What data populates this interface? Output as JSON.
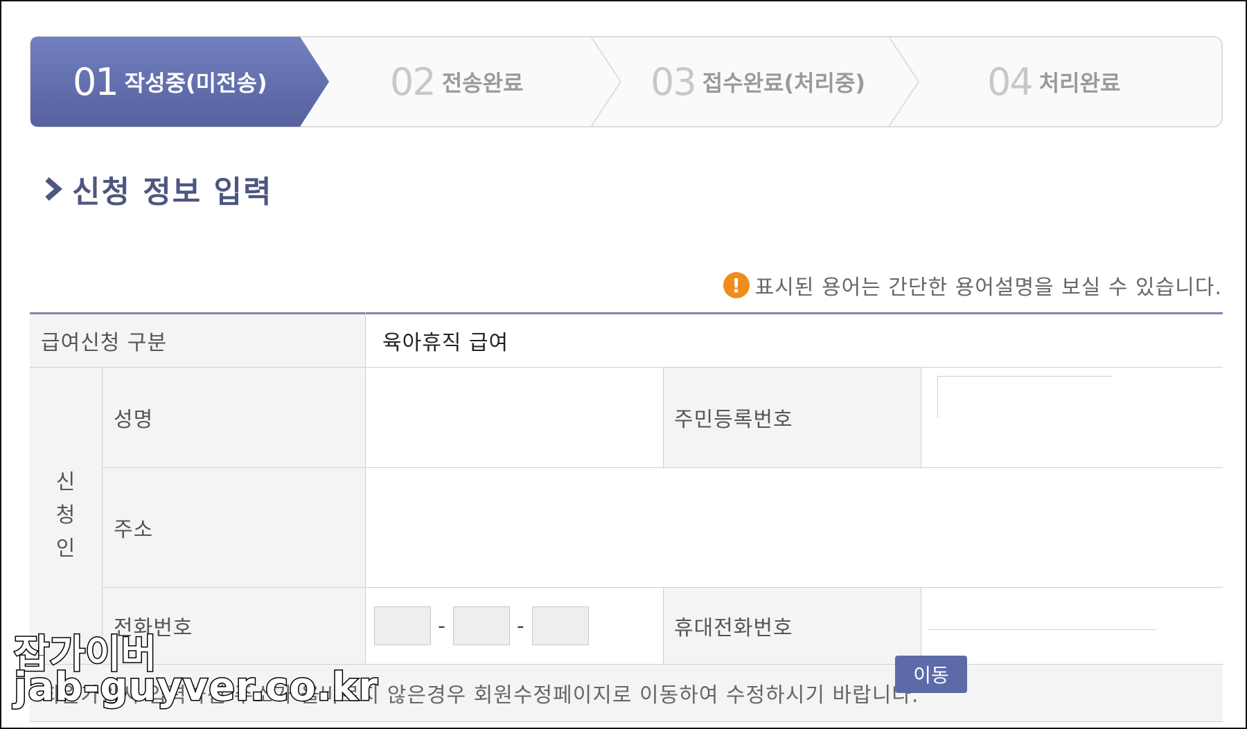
{
  "steps": [
    {
      "num": "01",
      "label": "작성중(미전송)",
      "active": true
    },
    {
      "num": "02",
      "label": "전송완료",
      "active": false
    },
    {
      "num": "03",
      "label": "접수완료(처리중)",
      "active": false
    },
    {
      "num": "04",
      "label": "처리완료",
      "active": false
    }
  ],
  "section_title": "신청 정보 입력",
  "notice": {
    "icon": "!",
    "text": "표시된 용어는 간단한 용어설명을 보실 수 있습니다."
  },
  "form": {
    "benefit_type_label": "급여신청 구분",
    "benefit_type_value": "육아휴직 급여",
    "applicant_group_label": "신\n청\n인",
    "name_label": "성명",
    "name_value": "",
    "rrn_label": "주민등록번호",
    "rrn_value": "",
    "address_label": "주소",
    "address_value": "",
    "phone_label": "전화번호",
    "phone_parts": [
      "",
      "",
      ""
    ],
    "phone_separator": "-",
    "mobile_label": "휴대전화번호",
    "mobile_value": "",
    "address_notice": "회원가입시 입력하신 주소가 올바르지 않은경우 회원수정페이지로 이동하여 수정하시기 바랍니다.",
    "move_button": "이동"
  },
  "watermark": {
    "line1": "잡가이버",
    "line2": "jab-guyver.co.kr"
  },
  "colors": {
    "accent": "#5c6aa8",
    "accent_dark": "#4d5680",
    "notice_icon": "#f08c1e"
  }
}
